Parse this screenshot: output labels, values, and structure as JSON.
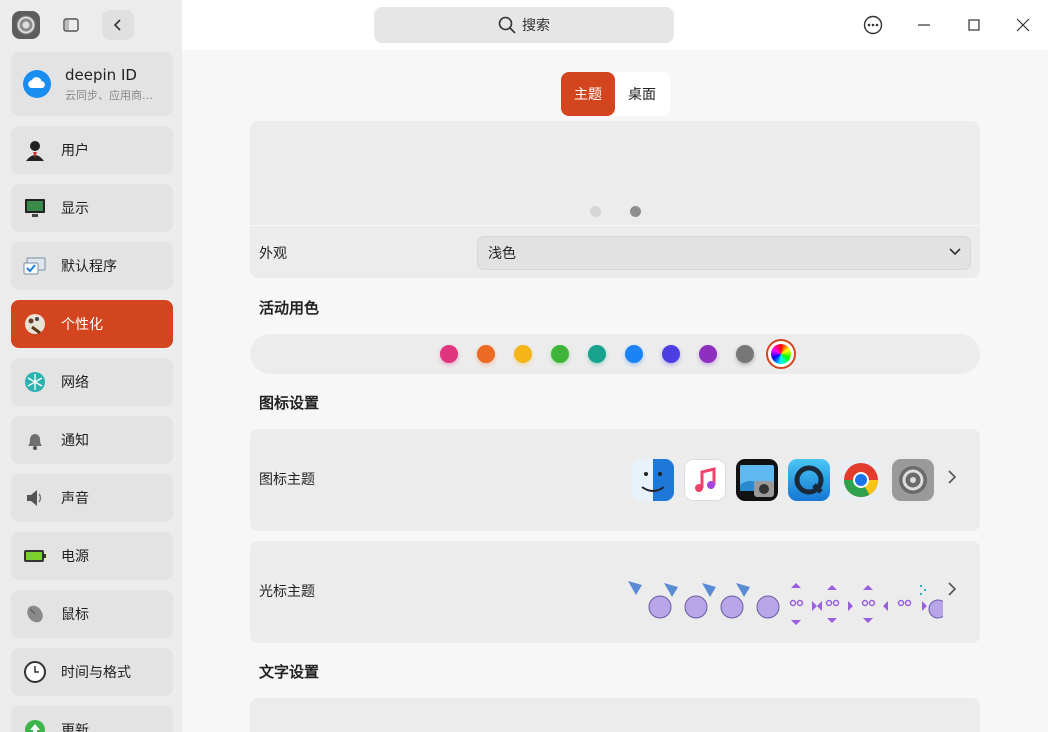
{
  "sidebar": {
    "account": {
      "title": "deepin ID",
      "subtitle": "云同步、应用商…"
    },
    "items": [
      {
        "label": "用户",
        "icon": "user-icon"
      },
      {
        "label": "显示",
        "icon": "display-icon"
      },
      {
        "label": "默认程序",
        "icon": "default-apps-icon"
      },
      {
        "label": "个性化",
        "icon": "personalization-icon",
        "active": true
      },
      {
        "label": "网络",
        "icon": "network-icon"
      },
      {
        "label": "通知",
        "icon": "bell-icon"
      },
      {
        "label": "声音",
        "icon": "speaker-icon"
      },
      {
        "label": "电源",
        "icon": "battery-icon"
      },
      {
        "label": "鼠标",
        "icon": "mouse-icon"
      },
      {
        "label": "时间与格式",
        "icon": "clock-icon"
      },
      {
        "label": "更新",
        "icon": "update-icon"
      }
    ]
  },
  "header": {
    "search_placeholder": "搜索"
  },
  "tabs": [
    {
      "label": "主题",
      "active": true
    },
    {
      "label": "桌面",
      "active": false
    }
  ],
  "appearance": {
    "label": "外观",
    "value": "浅色"
  },
  "accent": {
    "title": "活动用色",
    "colors": [
      "#e0357f",
      "#ec6a23",
      "#f5b418",
      "#3fb53a",
      "#17a38d",
      "#1b83f5",
      "#4c3ee0",
      "#8e2fc0",
      "#777777",
      "multicolor"
    ],
    "selected_index": 9,
    "brand": "#d2451e"
  },
  "icon_settings": {
    "title": "图标设置",
    "icon_theme_label": "图标主题",
    "cursor_theme_label": "光标主题"
  },
  "text_settings": {
    "title": "文字设置"
  }
}
